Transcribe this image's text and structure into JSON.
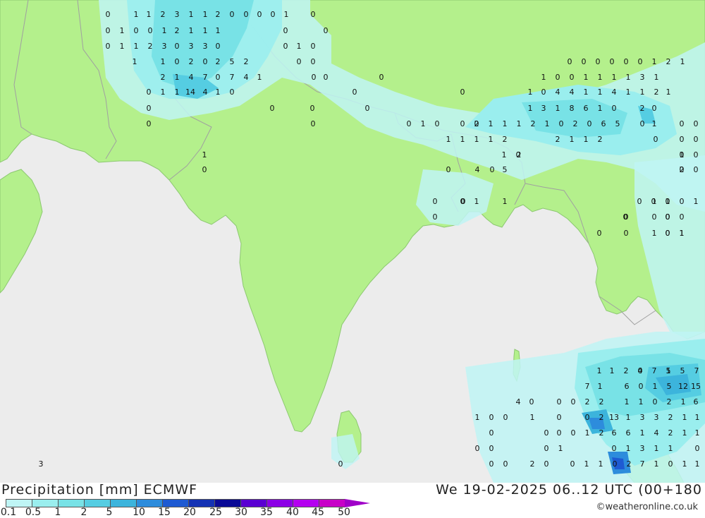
{
  "title": "Precipitation [mm] ECMWF",
  "datetime": "We 19-02-2025 06..12 UTC (00+180",
  "credit": "©weatheronline.co.uk",
  "colors": {
    "sea": "#ececec",
    "land": "#b4f08c",
    "border": "#a0a0a0"
  },
  "legend": {
    "labels": [
      "0.1",
      "0.5",
      "1",
      "2",
      "5",
      "10",
      "15",
      "20",
      "25",
      "30",
      "35",
      "40",
      "45",
      "50"
    ],
    "colors": [
      "#bff5f5",
      "#9aeeee",
      "#78e2e6",
      "#55cde2",
      "#3cb4dc",
      "#2d8cdc",
      "#1e5ad2",
      "#1432b4",
      "#0a0a96",
      "#5a00d2",
      "#8c00e6",
      "#b400f0",
      "#c800c8",
      "#a000c8"
    ]
  },
  "map_labels": [
    "0",
    "1",
    "1",
    "2",
    "3",
    "1",
    "1",
    "2",
    "0",
    "0",
    "0",
    "0",
    "1",
    "0",
    "0",
    "1",
    "0",
    "0",
    "1",
    "2",
    "1",
    "1",
    "1",
    "0",
    "0",
    "0",
    "1",
    "1",
    "2",
    "3",
    "0",
    "3",
    "3",
    "0",
    "0",
    "1",
    "0",
    "1",
    "1",
    "0",
    "2",
    "0",
    "2",
    "5",
    "2",
    "0",
    "0",
    "2",
    "1",
    "4",
    "7",
    "0",
    "7",
    "4",
    "1",
    "0",
    "0",
    "0",
    "0",
    "1",
    "1",
    "14",
    "4",
    "1",
    "0",
    "0",
    "0",
    "0",
    "0",
    "0",
    "0",
    "0",
    "0",
    "1",
    "0",
    "0",
    "0",
    "0",
    "0",
    "0",
    "0",
    "0",
    "0",
    "0",
    "1",
    "2",
    "1",
    "1",
    "0",
    "0",
    "1",
    "1",
    "1",
    "1",
    "3",
    "1",
    "1",
    "0",
    "4",
    "4",
    "1",
    "1",
    "4",
    "1",
    "1",
    "2",
    "1",
    "1",
    "3",
    "1",
    "8",
    "6",
    "1",
    "0",
    "2",
    "0",
    "2",
    "1",
    "1",
    "1",
    "2",
    "1",
    "0",
    "2",
    "0",
    "6",
    "5",
    "0",
    "1",
    "0",
    "0",
    "1",
    "1",
    "1",
    "1",
    "2",
    "2",
    "1",
    "1",
    "2",
    "0",
    "0",
    "0",
    "1",
    "0",
    "1",
    "0",
    "2",
    "1",
    "0",
    "4",
    "0",
    "5",
    "0",
    "0",
    "0",
    "0",
    "2",
    "0",
    "1",
    "1",
    "0",
    "0",
    "1",
    "0",
    "1",
    "0",
    "0",
    "1",
    "0",
    "0",
    "0",
    "0",
    "0",
    "0",
    "0",
    "0",
    "0",
    "1",
    "0",
    "1",
    "0",
    "0",
    "1",
    "0",
    "1",
    "1",
    "2",
    "0",
    "7",
    "1",
    "5",
    "7",
    "4",
    "5",
    "7",
    "1",
    "6",
    "0",
    "1",
    "5",
    "12",
    "15",
    "4",
    "0",
    "0",
    "0",
    "2",
    "2",
    "1",
    "1",
    "0",
    "2",
    "1",
    "6",
    "1",
    "0",
    "0",
    "1",
    "0",
    "0",
    "2",
    "13",
    "1",
    "3",
    "3",
    "2",
    "1",
    "1",
    "0",
    "0",
    "0",
    "0",
    "1",
    "2",
    "6",
    "6",
    "1",
    "4",
    "2",
    "1",
    "1",
    "0",
    "0",
    "0",
    "1",
    "0",
    "1",
    "3",
    "1",
    "1",
    "0",
    "0",
    "0",
    "2",
    "0",
    "0",
    "1",
    "1",
    "0",
    "2",
    "7",
    "1",
    "0",
    "1",
    "1",
    "3",
    "0",
    "0"
  ]
}
